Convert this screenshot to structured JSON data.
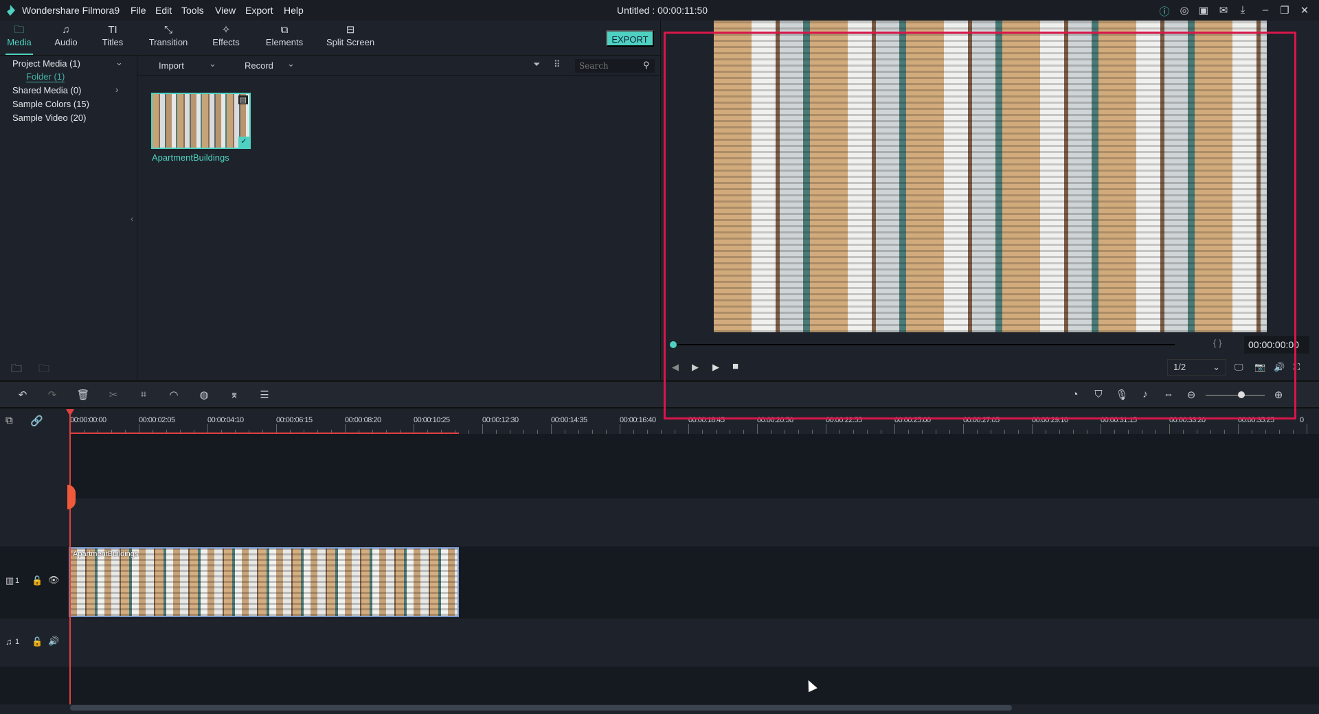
{
  "app": {
    "name": "Wondershare Filmora9",
    "title": "Untitled : 00:00:11:50",
    "menu": [
      "File",
      "Edit",
      "Tools",
      "View",
      "Export",
      "Help"
    ],
    "window_icons": [
      "info-icon",
      "account-icon",
      "save-icon",
      "mail-icon",
      "download-icon",
      "minimize-icon",
      "restore-icon",
      "close-icon"
    ]
  },
  "tabs": [
    {
      "label": "Media",
      "icon": "folder-icon",
      "active": true
    },
    {
      "label": "Audio",
      "icon": "music-icon"
    },
    {
      "label": "Titles",
      "icon": "text-icon"
    },
    {
      "label": "Transition",
      "icon": "transition-icon"
    },
    {
      "label": "Effects",
      "icon": "effects-icon"
    },
    {
      "label": "Elements",
      "icon": "elements-icon"
    },
    {
      "label": "Split Screen",
      "icon": "split-screen-icon"
    }
  ],
  "export_label": "EXPORT",
  "sidebar": {
    "items": [
      "Project Media (1)",
      "Folder (1)",
      "Shared Media (0)",
      "Sample Colors (15)",
      "Sample Video (20)"
    ]
  },
  "media": {
    "import_label": "Import",
    "record_label": "Record",
    "search_placeholder": "Search",
    "items": [
      {
        "name": "ApartmentBuildings",
        "selected": true
      }
    ]
  },
  "preview": {
    "timecode": "00:00:00:00",
    "quality": "1/2",
    "progress": 0,
    "marks": "{   }"
  },
  "ruler": [
    "00:00:00:00",
    "00:00:02:05",
    "00:00:04:10",
    "00:00:06:15",
    "00:00:08:20",
    "00:00:10:25",
    "00:00:12:30",
    "00:00:14:35",
    "00:00:16:40",
    "00:00:18:45",
    "00:00:20:50",
    "00:00:22:55",
    "00:00:25:00",
    "00:00:27:05",
    "00:00:29:10",
    "00:00:31:15",
    "00:00:33:20",
    "00:00:35:25",
    "0"
  ],
  "tracks": {
    "video_label": "1",
    "audio_label": "1",
    "clip_name": "ApartmentBuildings"
  },
  "colors": {
    "accent": "#4fd1c1",
    "highlight": "#d8164a",
    "playhead": "#e04040"
  }
}
